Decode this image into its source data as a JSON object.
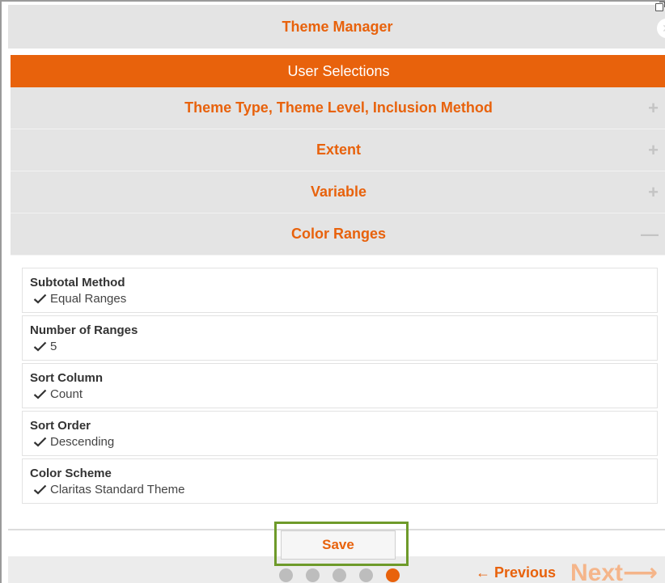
{
  "window": {
    "title": "Theme Manager"
  },
  "user_selections": {
    "label": "User Selections"
  },
  "accordion": [
    {
      "label": "Theme Type, Theme Level, Inclusion Method",
      "toggle": "+"
    },
    {
      "label": "Extent",
      "toggle": "+"
    },
    {
      "label": "Variable",
      "toggle": "+"
    },
    {
      "label": "Color Ranges",
      "toggle": "—"
    }
  ],
  "selections": [
    {
      "label": "Subtotal Method",
      "value": "Equal Ranges"
    },
    {
      "label": "Number of Ranges",
      "value": "5"
    },
    {
      "label": "Sort Column",
      "value": "Count"
    },
    {
      "label": "Sort Order",
      "value": "Descending"
    },
    {
      "label": "Color Scheme",
      "value": "Claritas Standard Theme"
    }
  ],
  "footer": {
    "save_label": "Save",
    "previous_label": "← Previous",
    "next_label": "Next⟶",
    "steps_total": 5,
    "current_step": 5
  },
  "colors": {
    "accent": "#e8620c",
    "header_bg": "#e4e4e4",
    "highlight_outline": "#6e9a2a",
    "dot_inactive": "#bdbdbd"
  },
  "icons": {
    "close": "close-icon",
    "popout": "popout-icon",
    "check": "checkmark-icon",
    "expand": "plus-icon",
    "collapse": "minus-icon"
  }
}
